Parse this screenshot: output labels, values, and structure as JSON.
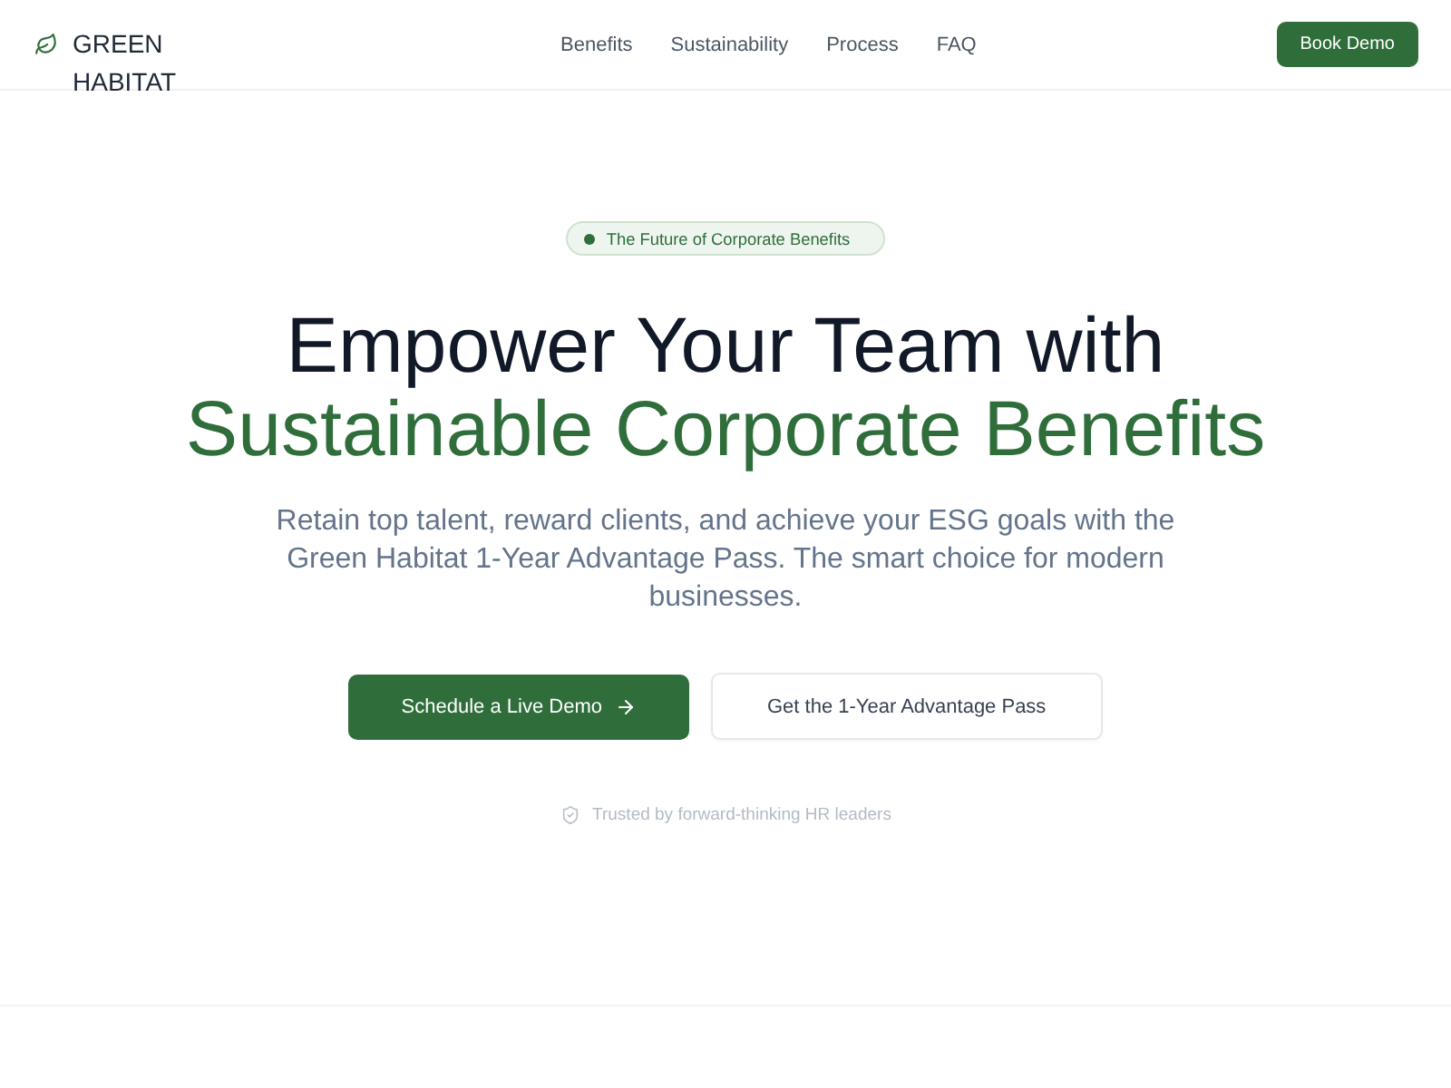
{
  "header": {
    "brand": "GREEN HABITAT",
    "nav": [
      "Benefits",
      "Sustainability",
      "Process",
      "FAQ"
    ],
    "cta": "Book Demo"
  },
  "hero": {
    "badge": "The Future of Corporate Benefits",
    "title_line_1": "Empower Your Team with",
    "title_line_2": "Sustainable Corporate Benefits",
    "description": "Retain top talent, reward clients, and achieve your ESG goals with the Green Habitat 1-Year Advantage Pass. The smart choice for modern businesses.",
    "buttons": [
      {
        "label": "Schedule a Live Demo",
        "kind": "primary"
      },
      {
        "label": "Get the 1-Year Advantage Pass",
        "kind": "secondary"
      }
    ],
    "trust_note": "Trusted by forward-thinking HR leaders"
  }
}
